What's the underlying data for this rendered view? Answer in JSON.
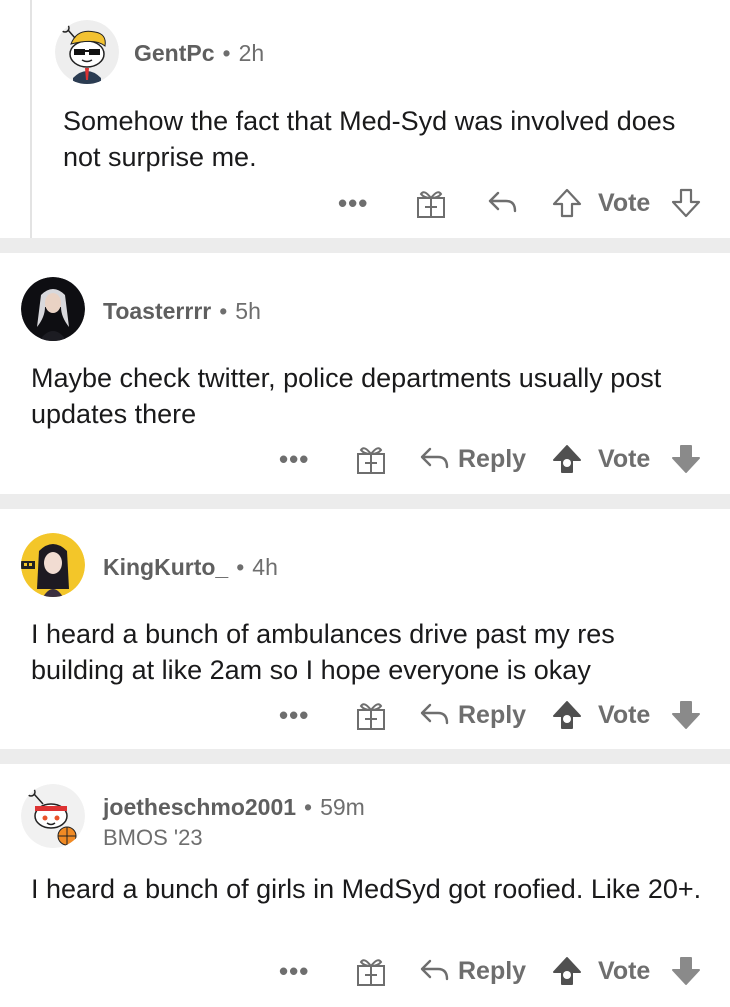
{
  "comments": [
    {
      "username": "GentPc",
      "separator": "•",
      "time": "2h",
      "flair": "",
      "text": "Somehow the fact that Med-Syd was involved does not surprise me.",
      "more_label": "•••",
      "reply_label": "",
      "vote_label": "Vote",
      "avatar_icon": "snoo-sunglasses-avatar"
    },
    {
      "username": "Toasterrrr",
      "separator": "•",
      "time": "5h",
      "flair": "",
      "text": "Maybe check twitter, police departments usually post updates there",
      "more_label": "•••",
      "reply_label": "Reply",
      "vote_label": "Vote",
      "avatar_icon": "photo-avatar"
    },
    {
      "username": "KingKurto_",
      "separator": "•",
      "time": "4h",
      "flair": "",
      "text": "I heard a bunch of ambulances drive past my res building at like 2am so I hope everyone is okay",
      "more_label": "•••",
      "reply_label": "Reply",
      "vote_label": "Vote",
      "avatar_icon": "anime-avatar"
    },
    {
      "username": "joetheschmo2001",
      "separator": "•",
      "time": "59m",
      "flair": "BMOS '23",
      "text": "I heard a bunch of girls in MedSyd got roofied. Like 20+.",
      "more_label": "•••",
      "reply_label": "Reply",
      "vote_label": "Vote",
      "avatar_icon": "snoo-basketball-avatar"
    }
  ],
  "colors": {
    "meta_gray": "#6e6e6e",
    "text": "#1a1a1b",
    "separator_bg": "#ececec",
    "thread_line": "#e3e3e3"
  }
}
